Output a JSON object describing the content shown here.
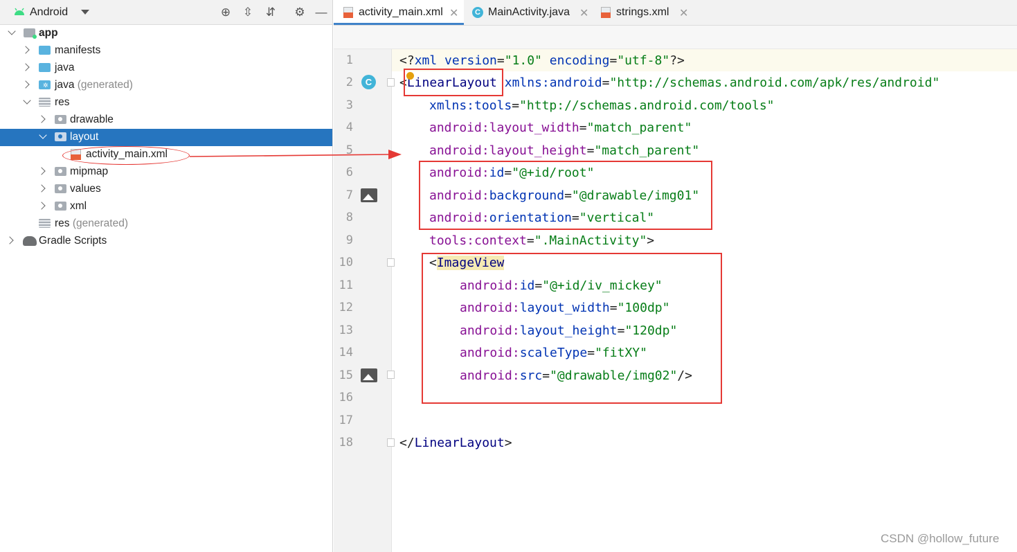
{
  "project_panel": {
    "view_label": "Android",
    "toolbar_icons": [
      "locate-icon",
      "expand-all-icon",
      "collapse-all-icon",
      "gear-icon",
      "minimize-icon"
    ],
    "tree": [
      {
        "label": "app",
        "icon": "module-icon",
        "expanded": true
      },
      {
        "label": "manifests",
        "icon": "folder-icon"
      },
      {
        "label": "java",
        "icon": "folder-icon"
      },
      {
        "label": "java",
        "suffix": "(generated)",
        "icon": "generated-folder-icon"
      },
      {
        "label": "res",
        "icon": "resources-folder-icon",
        "expanded": true
      },
      {
        "label": "drawable",
        "icon": "folder-icon"
      },
      {
        "label": "layout",
        "icon": "folder-icon",
        "selected": true,
        "expanded": true
      },
      {
        "label": "activity_main.xml",
        "icon": "xml-file-icon"
      },
      {
        "label": "mipmap",
        "icon": "folder-icon"
      },
      {
        "label": "values",
        "icon": "folder-icon"
      },
      {
        "label": "xml",
        "icon": "folder-icon"
      },
      {
        "label": "res",
        "suffix": "(generated)",
        "icon": "resources-folder-icon"
      },
      {
        "label": "Gradle Scripts",
        "icon": "gradle-elephant-icon"
      }
    ]
  },
  "editor": {
    "tabs": [
      {
        "label": "activity_main.xml",
        "icon": "xml-file-icon",
        "active": true
      },
      {
        "label": "MainActivity.java",
        "icon": "class-icon",
        "active": false
      },
      {
        "label": "strings.xml",
        "icon": "xml-file-icon",
        "active": false
      }
    ],
    "line_numbers": [
      "1",
      "2",
      "3",
      "4",
      "5",
      "6",
      "7",
      "8",
      "9",
      "10",
      "11",
      "12",
      "13",
      "14",
      "15",
      "16",
      "17",
      "18"
    ],
    "gutter_class_letter": "C",
    "code": {
      "l1": {
        "a": "<?",
        "b": "xml version",
        "c": "=",
        "d": "\"1.0\"",
        "e": " encoding",
        "f": "=",
        "g": "\"utf-8\"",
        "h": "?>"
      },
      "l2": {
        "a": "<",
        "b": "LinearLayout",
        "c": " xmlns:",
        "d": "android",
        "e": "=",
        "f": "\"http://schemas.android.com/apk/res/android\""
      },
      "l3": {
        "a": "xmlns:",
        "b": "tools",
        "c": "=",
        "d": "\"http://schemas.android.com/tools\""
      },
      "l4": {
        "a": "android:",
        "b": "layout_width",
        "c": "=",
        "d": "\"match_parent\""
      },
      "l5": {
        "a": "android:",
        "b": "layout_height",
        "c": "=",
        "d": "\"match_parent\""
      },
      "l6": {
        "a": "android:",
        "b": "id",
        "c": "=",
        "d": "\"@+id/root\""
      },
      "l7": {
        "a": "android:",
        "b": "background",
        "c": "=",
        "d": "\"@drawable/img01\""
      },
      "l8": {
        "a": "android:",
        "b": "orientation",
        "c": "=",
        "d": "\"vertical\""
      },
      "l9": {
        "a": "tools:",
        "b": "context",
        "c": "=",
        "d": "\".MainActivity\"",
        "e": ">"
      },
      "l10": {
        "a": "<",
        "b": "ImageView"
      },
      "l11": {
        "a": "android:",
        "b": "id",
        "c": "=",
        "d": "\"@+id/iv_mickey\""
      },
      "l12": {
        "a": "android:",
        "b": "layout_width",
        "c": "=",
        "d": "\"100dp\""
      },
      "l13": {
        "a": "android:",
        "b": "layout_height",
        "c": "=",
        "d": "\"120dp\""
      },
      "l14": {
        "a": "android:",
        "b": "scaleType",
        "c": "=",
        "d": "\"fitXY\""
      },
      "l15": {
        "a": "android:",
        "b": "src",
        "c": "=",
        "d": "\"@drawable/img02\"",
        "e": "/>"
      },
      "l18": {
        "a": "</",
        "b": "LinearLayout",
        "c": ">"
      }
    }
  },
  "colors": {
    "selection": "#2675bf",
    "annotation_red": "#e53935",
    "xml_tag": "#000080",
    "xml_attr": "#871094",
    "xml_value": "#067d17"
  },
  "watermark": "CSDN @hollow_future"
}
